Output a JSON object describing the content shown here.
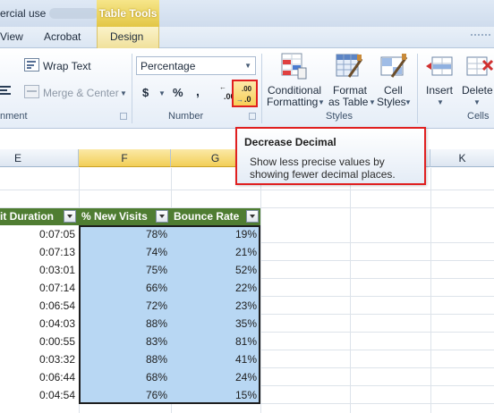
{
  "window": {
    "title": "ercial use",
    "contextual_tab": "Table Tools"
  },
  "tabs": [
    {
      "label": "View"
    },
    {
      "label": "Acrobat"
    },
    {
      "label": "Design"
    }
  ],
  "alignment": {
    "wrap_text_label": "Wrap Text",
    "merge_center_label": "Merge & Center",
    "group_label": "nment"
  },
  "number": {
    "format_value": "Percentage",
    "currency_symbol": "$",
    "percent_symbol": "%",
    "comma_symbol": ",",
    "increase_decimal_label": "Increase Decimal",
    "decrease_decimal_label": "Decrease Decimal",
    "group_label": "Number"
  },
  "styles": {
    "conditional_line1": "Conditional",
    "conditional_line2": "Formatting",
    "format_table_line1": "Format",
    "format_table_line2": "as Table",
    "cell_styles_line1": "Cell",
    "cell_styles_line2": "Styles",
    "group_label": "Styles"
  },
  "cells": {
    "insert_label": "Insert",
    "delete_label": "Delete",
    "group_label": "Cells"
  },
  "tooltip": {
    "title": "Decrease Decimal",
    "description": "Show less precise values by showing fewer decimal places."
  },
  "columns": [
    "E",
    "F",
    "G",
    "H",
    "I",
    "J",
    "K"
  ],
  "table": {
    "headers": [
      "it Duration",
      "% New Visits",
      "Bounce Rate"
    ],
    "rows": [
      [
        "0:07:05",
        "78%",
        "19%"
      ],
      [
        "0:07:13",
        "74%",
        "21%"
      ],
      [
        "0:03:01",
        "75%",
        "52%"
      ],
      [
        "0:07:14",
        "66%",
        "22%"
      ],
      [
        "0:06:54",
        "72%",
        "23%"
      ],
      [
        "0:04:03",
        "88%",
        "35%"
      ],
      [
        "0:00:55",
        "83%",
        "81%"
      ],
      [
        "0:03:32",
        "88%",
        "41%"
      ],
      [
        "0:06:44",
        "68%",
        "24%"
      ],
      [
        "0:04:54",
        "76%",
        "15%"
      ]
    ]
  },
  "colors": {
    "header_green": "#4f7d32",
    "selection_blue": "#b8d7f3",
    "highlight_red": "#e02020",
    "ribbon_gold": "#f7cf57"
  }
}
